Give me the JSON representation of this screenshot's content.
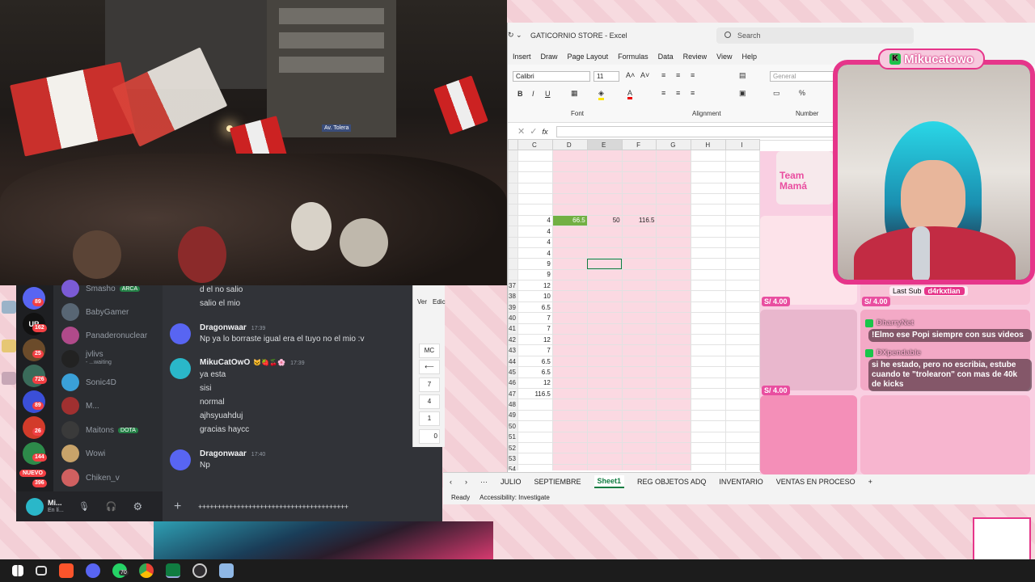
{
  "excel": {
    "title": "GATICORNIO STORE  -  Excel",
    "search_placeholder": "Search",
    "menu": [
      "Insert",
      "Draw",
      "Page Layout",
      "Formulas",
      "Data",
      "Review",
      "View",
      "Help"
    ],
    "font_name": "Calibri",
    "font_size": "11",
    "number_format": "General",
    "group_labels": {
      "font": "Font",
      "alignment": "Alignment",
      "number": "Number"
    },
    "formula_label": "fx",
    "columns": [
      "C",
      "D",
      "E",
      "F",
      "G",
      "H",
      "I"
    ],
    "rows": [
      {
        "n": "",
        "c": "",
        "d": "",
        "e": "",
        "f": ""
      },
      {
        "n": "",
        "c": "",
        "d": "",
        "e": "",
        "f": ""
      },
      {
        "n": "",
        "c": "",
        "d": "",
        "e": "",
        "f": ""
      },
      {
        "n": "",
        "c": "",
        "d": "",
        "e": "",
        "f": ""
      },
      {
        "n": "",
        "c": "",
        "d": "",
        "e": "",
        "f": ""
      },
      {
        "n": "",
        "c": "",
        "d": "",
        "e": "",
        "f": ""
      },
      {
        "n": "",
        "c": "4",
        "d": "66.5",
        "e": "50",
        "f": "116.5"
      },
      {
        "n": "",
        "c": "4",
        "d": "",
        "e": "",
        "f": ""
      },
      {
        "n": "",
        "c": "4",
        "d": "",
        "e": "",
        "f": ""
      },
      {
        "n": "",
        "c": "4",
        "d": "",
        "e": "",
        "f": ""
      },
      {
        "n": "",
        "c": "9",
        "d": "",
        "e": "",
        "f": ""
      },
      {
        "n": "",
        "c": "9",
        "d": "",
        "e": "",
        "f": ""
      },
      {
        "n": "37",
        "c": "12",
        "d": "",
        "e": "",
        "f": ""
      },
      {
        "n": "38",
        "c": "10",
        "d": "",
        "e": "",
        "f": ""
      },
      {
        "n": "39",
        "c": "6.5",
        "d": "",
        "e": "",
        "f": ""
      },
      {
        "n": "40",
        "c": "7",
        "d": "",
        "e": "",
        "f": ""
      },
      {
        "n": "41",
        "c": "7",
        "d": "",
        "e": "",
        "f": ""
      },
      {
        "n": "42",
        "c": "12",
        "d": "",
        "e": "",
        "f": ""
      },
      {
        "n": "43",
        "c": "7",
        "d": "",
        "e": "",
        "f": ""
      },
      {
        "n": "44",
        "c": "6.5",
        "d": "",
        "e": "",
        "f": ""
      },
      {
        "n": "45",
        "c": "6.5",
        "d": "",
        "e": "",
        "f": ""
      },
      {
        "n": "46",
        "c": "12",
        "d": "",
        "e": "",
        "f": ""
      },
      {
        "n": "47",
        "c": "116.5",
        "d": "",
        "e": "",
        "f": ""
      },
      {
        "n": "48",
        "c": "",
        "d": "",
        "e": "",
        "f": ""
      },
      {
        "n": "49",
        "c": "",
        "d": "",
        "e": "",
        "f": ""
      },
      {
        "n": "50",
        "c": "",
        "d": "",
        "e": "",
        "f": ""
      },
      {
        "n": "51",
        "c": "",
        "d": "",
        "e": "",
        "f": ""
      },
      {
        "n": "52",
        "c": "",
        "d": "",
        "e": "",
        "f": ""
      },
      {
        "n": "53",
        "c": "",
        "d": "",
        "e": "",
        "f": ""
      },
      {
        "n": "54",
        "c": "",
        "d": "",
        "e": "",
        "f": ""
      }
    ],
    "sheet_tabs": [
      "JULIO",
      "SEPTIEMBRE",
      "Sheet1",
      "REG OBJETOS ADQ",
      "INVENTARIO",
      "VENTAS EN PROCESO"
    ],
    "active_tab": "Sheet1",
    "status_ready": "Ready",
    "status_access": "Accessibility: Investigate",
    "accent": "#107c41"
  },
  "shop": {
    "price": "S/ 4.00",
    "banner": "Team Mamá"
  },
  "discord": {
    "guild_badges": [
      "89",
      "162",
      "25",
      "726",
      "89",
      "26",
      "144",
      "396"
    ],
    "nuevo_label": "NUEVO",
    "members": [
      {
        "name": "Smasho",
        "tag": "ARCA"
      },
      {
        "name": "BabyGamer",
        "tag": ""
      },
      {
        "name": "Panaderonuclear",
        "tag": ""
      },
      {
        "name": "jvlivs",
        "sub": "- ...waiting",
        "tag": ""
      },
      {
        "name": "Sonic4D",
        "tag": ""
      },
      {
        "name": "M...",
        "tag": ""
      },
      {
        "name": "Maitons",
        "tag": "DOTA"
      },
      {
        "name": "Wowi",
        "tag": ""
      },
      {
        "name": "Chiken_v",
        "tag": ""
      }
    ],
    "messages": {
      "pre1": "d el no salio",
      "pre2": "salio el mio",
      "m1_author": "Dragonwaar",
      "m1_time": "17:39",
      "m1_text": "Np ya lo borraste igual era el tuyo no el mio :v",
      "m2_author": "MikuCatOwO",
      "m2_time": "17:39",
      "m2_lines": [
        "ya esta",
        "sisi",
        "normal",
        "ajhsyuahduj",
        "gracias haycc"
      ],
      "m3_author": "Dragonwaar",
      "m3_time": "17:40",
      "m3_text": "Np"
    },
    "user_name": "Mi...",
    "user_status": "En lí...",
    "composer_text": "+++++++++++++++++++++++++++++++++++++++"
  },
  "calc": {
    "tabs": [
      "Ver",
      "Edic"
    ],
    "keys": [
      "MC",
      "⟵",
      "7",
      "4",
      "1",
      "0"
    ]
  },
  "stream": {
    "title": "Mikucatowo",
    "last_sub_label": "Last Sub",
    "last_sub_name": "d4rkxtian",
    "chat": [
      {
        "user": "DharryNet",
        "text": "!Elmo ese Popi siempre con sus videos"
      },
      {
        "user": "DXpendable",
        "text": "si he estado, pero no escribia, estube cuando te \"trolearon\" con mas de 40k de kicks"
      }
    ]
  },
  "taskbar": {
    "whatsapp_badge": "70"
  }
}
